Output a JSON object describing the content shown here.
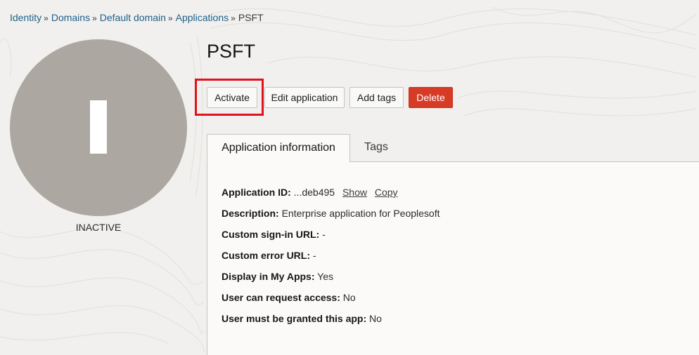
{
  "breadcrumb": {
    "items": [
      "Identity",
      "Domains",
      "Default domain",
      "Applications"
    ],
    "separator": "»",
    "current": "PSFT"
  },
  "avatar": {
    "status": "INACTIVE",
    "color": "#aca7a0"
  },
  "page": {
    "title": "PSFT"
  },
  "actions": {
    "activate": "Activate",
    "edit": "Edit application",
    "add_tags": "Add tags",
    "delete": "Delete",
    "delete_color": "#d63b25",
    "highlight_color": "#e2111d"
  },
  "tabs": {
    "info": "Application information",
    "tags": "Tags"
  },
  "info": {
    "app_id": {
      "label": "Application ID:",
      "value": "...deb495",
      "show": "Show",
      "copy": "Copy"
    },
    "description": {
      "label": "Description:",
      "value": "Enterprise application for Peoplesoft"
    },
    "signin_url": {
      "label": "Custom sign-in URL:",
      "value": "-"
    },
    "error_url": {
      "label": "Custom error URL:",
      "value": "-"
    },
    "my_apps": {
      "label": "Display in My Apps:",
      "value": "Yes"
    },
    "request_access": {
      "label": "User can request access:",
      "value": "No"
    },
    "must_grant": {
      "label": "User must be granted this app:",
      "value": "No"
    }
  }
}
